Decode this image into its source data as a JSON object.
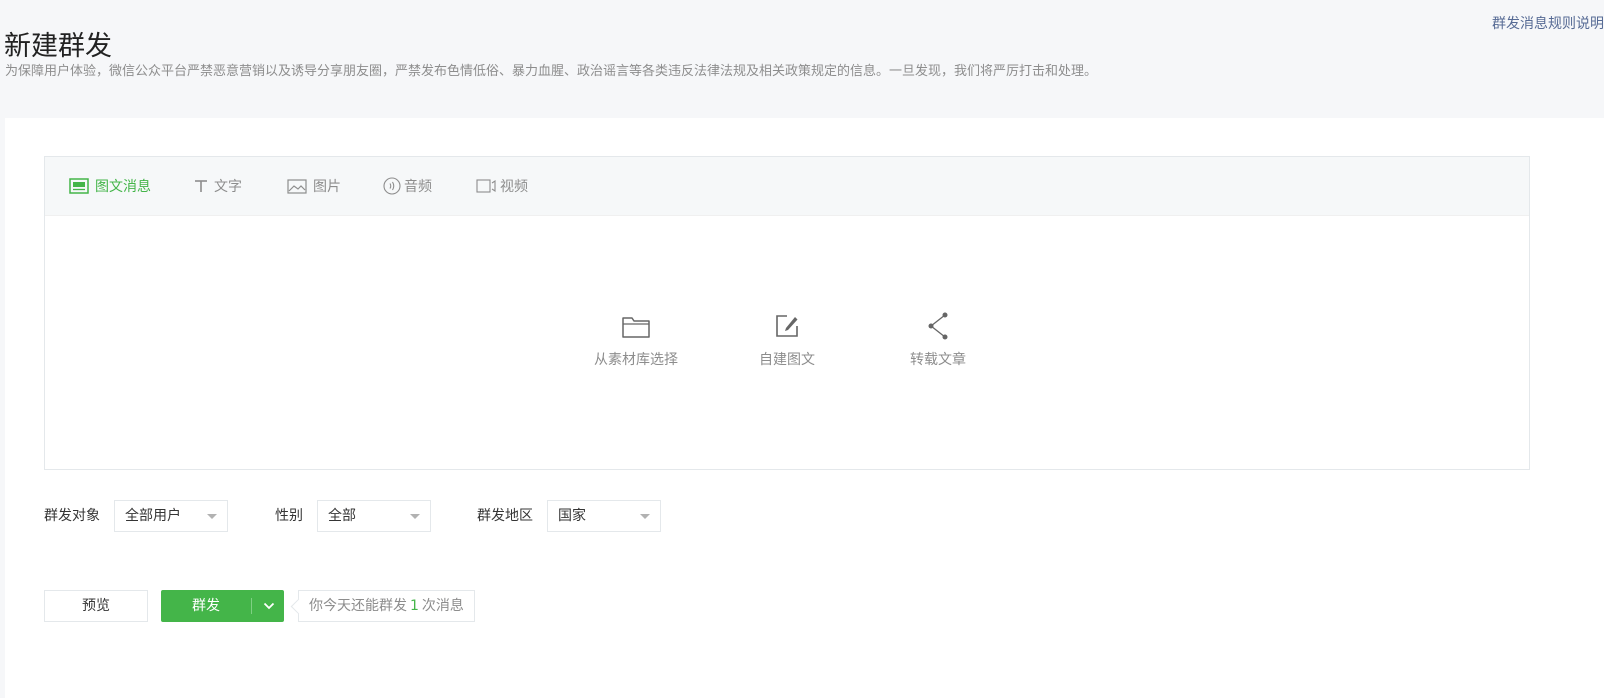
{
  "header": {
    "title": "新建群发",
    "rules_link": "群发消息规则说明",
    "notice": "为保障用户体验，微信公众平台严禁恶意营销以及诱导分享朋友圈，严禁发布色情低俗、暴力血腥、政治谣言等各类违反法律法规及相关政策规定的信息。一旦发现，我们将严厉打击和处理。"
  },
  "editor": {
    "tabs": [
      {
        "label": "图文消息",
        "icon": "news-icon",
        "active": true
      },
      {
        "label": "文字",
        "icon": "text-icon",
        "active": false
      },
      {
        "label": "图片",
        "icon": "image-icon",
        "active": false
      },
      {
        "label": "音频",
        "icon": "audio-icon",
        "active": false
      },
      {
        "label": "视频",
        "icon": "video-icon",
        "active": false
      }
    ],
    "actions": [
      {
        "label": "从素材库选择",
        "icon": "folder-icon"
      },
      {
        "label": "自建图文",
        "icon": "edit-icon"
      },
      {
        "label": "转载文章",
        "icon": "share-icon"
      }
    ]
  },
  "filters": {
    "target": {
      "label": "群发对象",
      "value": "全部用户"
    },
    "gender": {
      "label": "性别",
      "value": "全部"
    },
    "region": {
      "label": "群发地区",
      "value": "国家"
    }
  },
  "footer": {
    "preview": "预览",
    "send": "群发",
    "quota_prefix": "你今天还能群发",
    "quota_count": "1",
    "quota_suffix": "次消息"
  },
  "colors": {
    "accent": "#44b549",
    "link": "#576b95",
    "muted": "#8d8d8d",
    "border": "#e4e8eb",
    "page_bg": "#f6f7f9"
  }
}
